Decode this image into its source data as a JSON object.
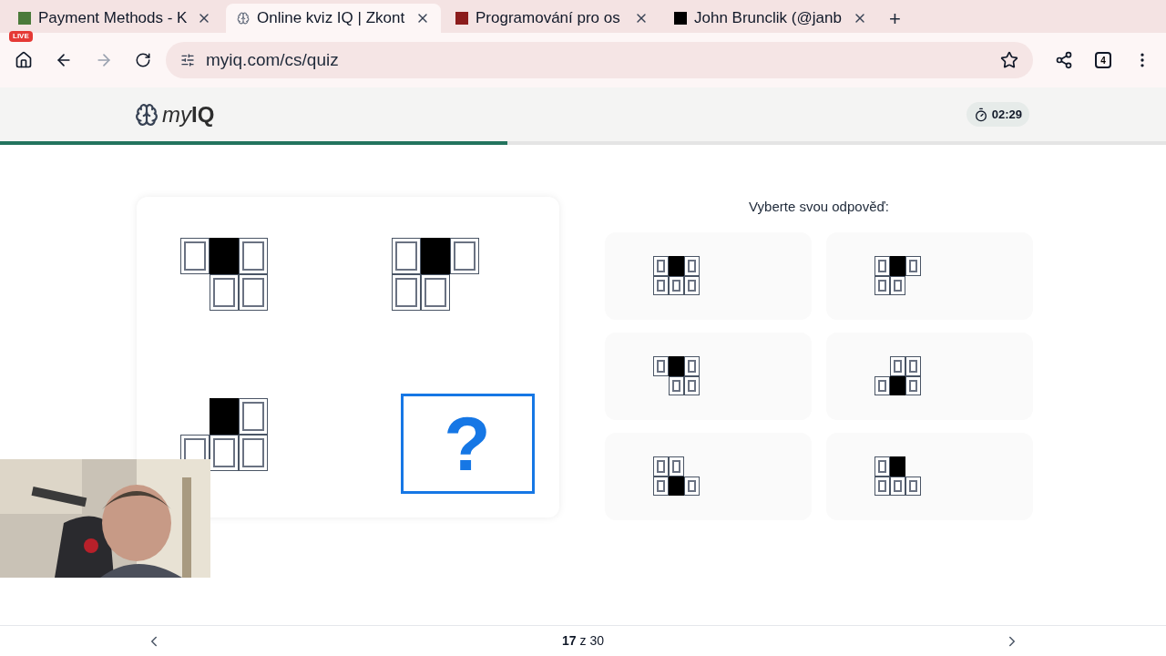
{
  "browser": {
    "tabs": [
      {
        "title": "Payment Methods - K",
        "selected": false,
        "live_badge": "LIVE"
      },
      {
        "title": "Online kviz IQ | Zkont",
        "selected": true
      },
      {
        "title": "Programování pro os",
        "selected": false
      },
      {
        "title": "John Brunclik (@janb",
        "selected": false
      }
    ],
    "new_tab": "+",
    "url": "myiq.com/cs/quiz",
    "extensions_count": "4"
  },
  "site": {
    "logo_light": "my",
    "logo_bold": "IQ",
    "timer": "02:29",
    "progress": {
      "level": 0.435
    }
  },
  "question": {
    "figures": [
      {
        "kind": "figure",
        "cells": [
          [
            {
              "kind": "empty"
            },
            {
              "kind": "filled"
            },
            {
              "kind": "empty"
            }
          ],
          [
            {
              "kind": "gap"
            },
            {
              "kind": "empty"
            },
            {
              "kind": "empty"
            }
          ]
        ]
      },
      {
        "kind": "figure",
        "cells": [
          [
            {
              "kind": "empty"
            },
            {
              "kind": "filled"
            },
            {
              "kind": "empty"
            }
          ],
          [
            {
              "kind": "empty"
            },
            {
              "kind": "empty"
            },
            {
              "kind": "gap"
            }
          ]
        ]
      },
      {
        "kind": "figure",
        "cells": [
          [
            {
              "kind": "gap"
            },
            {
              "kind": "filled"
            },
            {
              "kind": "empty"
            }
          ],
          [
            {
              "kind": "empty"
            },
            {
              "kind": "empty"
            },
            {
              "kind": "empty"
            }
          ]
        ]
      },
      {
        "kind": "missing",
        "symbol": "?"
      }
    ]
  },
  "answers": {
    "prompt": "Vyberte svou odpověď:",
    "options": [
      {
        "selected": false,
        "cells": [
          [
            {
              "kind": "empty"
            },
            {
              "kind": "filled"
            },
            {
              "kind": "empty"
            }
          ],
          [
            {
              "kind": "empty"
            },
            {
              "kind": "empty"
            },
            {
              "kind": "empty"
            }
          ]
        ]
      },
      {
        "selected": false,
        "cells": [
          [
            {
              "kind": "empty"
            },
            {
              "kind": "filled"
            },
            {
              "kind": "empty"
            }
          ],
          [
            {
              "kind": "empty"
            },
            {
              "kind": "empty"
            },
            {
              "kind": "gap"
            }
          ]
        ]
      },
      {
        "selected": false,
        "cells": [
          [
            {
              "kind": "empty"
            },
            {
              "kind": "filled"
            },
            {
              "kind": "empty"
            }
          ],
          [
            {
              "kind": "gap"
            },
            {
              "kind": "empty"
            },
            {
              "kind": "empty"
            }
          ]
        ]
      },
      {
        "selected": false,
        "cells": [
          [
            {
              "kind": "gap"
            },
            {
              "kind": "empty"
            },
            {
              "kind": "empty"
            }
          ],
          [
            {
              "kind": "empty"
            },
            {
              "kind": "filled"
            },
            {
              "kind": "empty"
            }
          ]
        ]
      },
      {
        "selected": false,
        "cells": [
          [
            {
              "kind": "empty"
            },
            {
              "kind": "empty"
            },
            {
              "kind": "gap"
            }
          ],
          [
            {
              "kind": "empty"
            },
            {
              "kind": "filled"
            },
            {
              "kind": "empty"
            }
          ]
        ]
      },
      {
        "selected": false,
        "cells": [
          [
            {
              "kind": "empty"
            },
            {
              "kind": "filled"
            },
            {
              "kind": "gap"
            }
          ],
          [
            {
              "kind": "empty"
            },
            {
              "kind": "empty"
            },
            {
              "kind": "empty"
            }
          ]
        ]
      }
    ]
  },
  "footer": {
    "page_current": "17",
    "page_sep": "z",
    "page_total": "30"
  }
}
